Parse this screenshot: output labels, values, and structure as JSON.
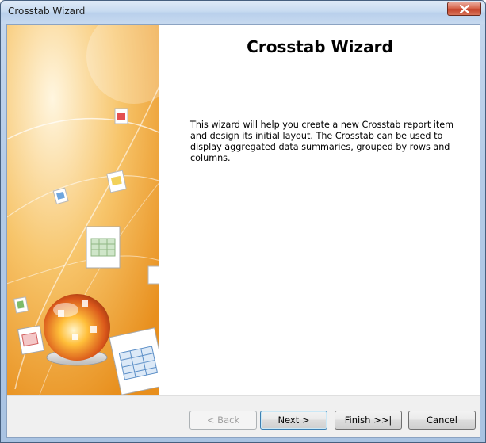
{
  "window": {
    "title": "Crosstab Wizard"
  },
  "main": {
    "heading": "Crosstab Wizard",
    "description": "This wizard will help you create a new Crosstab report item and design its initial layout. The Crosstab can be used to display aggregated data summaries, grouped by rows and columns."
  },
  "buttons": {
    "back": "< Back",
    "next": "Next >",
    "finish": "Finish >>|",
    "cancel": "Cancel"
  },
  "icons": {
    "close": "close-icon",
    "side_image": "wizard-banner-image"
  },
  "colors": {
    "banner_orange": "#f2b24a",
    "default_button_border": "#3c7fb1"
  }
}
